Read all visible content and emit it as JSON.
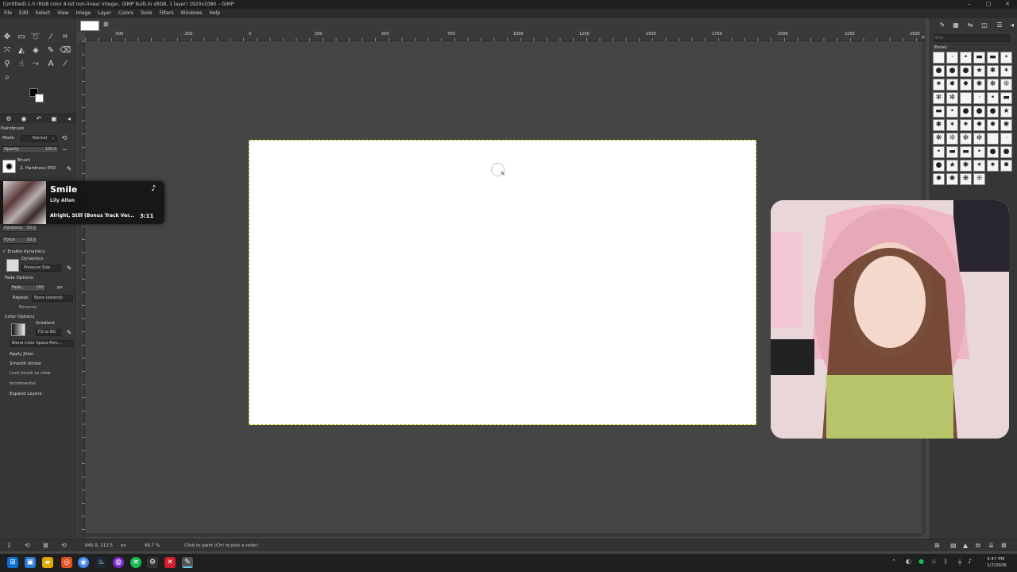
{
  "window": {
    "title": "[Untitled]-1.0 (RGB color 8-bit non-linear integer, GIMP built-in sRGB, 1 layer) 1920x1080 – GIMP"
  },
  "menu": [
    "File",
    "Edit",
    "Select",
    "View",
    "Image",
    "Layer",
    "Colors",
    "Tools",
    "Filters",
    "Windows",
    "Help"
  ],
  "ruler": {
    "top_ticks": [
      "-500",
      "-250",
      "0",
      "250",
      "500",
      "750",
      "1000",
      "1250",
      "1500",
      "1750",
      "2000",
      "2250",
      "2500"
    ]
  },
  "tool_options": {
    "title": "Paintbrush",
    "mode_label": "Mode",
    "mode_value": "Normal",
    "opacity_label": "Opacity",
    "opacity_value": "100.0",
    "brush_label": "Brush",
    "brush_value": "2. Hardness 050",
    "hardness_label": "Hardness",
    "hardness_value": "50.0",
    "force_label": "Force",
    "force_value": "50.0",
    "enable_dynamics": "Enable dynamics",
    "dynamics_label": "Dynamics",
    "dynamics_value": "Pressure Size",
    "fade_options": "Fade Options",
    "fade_length_label": "Fade...",
    "fade_length_value": "100",
    "fade_unit": "px",
    "repeat_label": "Repeat",
    "repeat_value": "None (extend)",
    "reverse": "Reverse",
    "color_options": "Color Options",
    "gradient_label": "Gradient",
    "gradient_value": "FG to BG",
    "blend_space": "Blend Color Space Perc...",
    "apply_jitter": "Apply Jitter",
    "smooth_stroke": "Smooth stroke",
    "lock_brush": "Lock brush to view",
    "incremental": "Incremental",
    "expand_layers": "Expand Layers"
  },
  "music": {
    "song": "Smile",
    "artist": "Lily Allen",
    "album": "Alright, Still (Bonus Track Ver...",
    "duration": "3:11"
  },
  "brushes": {
    "filter_placeholder": "filter",
    "selected": "(None)"
  },
  "status": {
    "coords": "945.0, 112.5",
    "unit": "px",
    "zoom": "66.7 %",
    "message": "Click to paint (Ctrl to pick a color)"
  },
  "taskbar": {
    "time": "3:47 PM",
    "date": "1/7/2026"
  },
  "colors": {
    "accent_yellow": "#c8c400",
    "spotify_green": "#1db954"
  }
}
